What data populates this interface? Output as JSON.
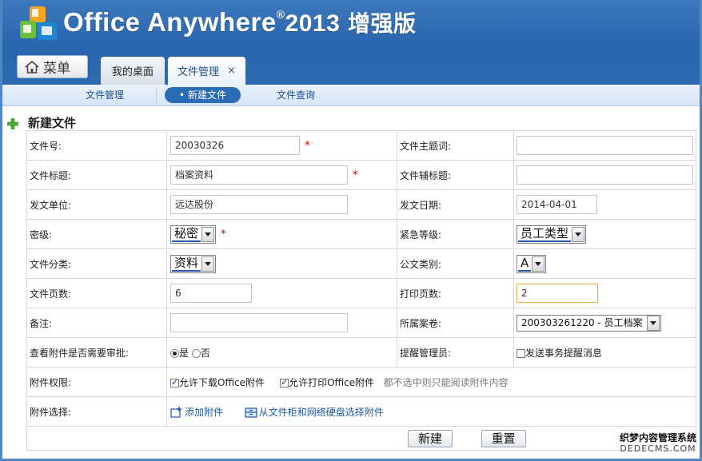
{
  "brand": {
    "name": "Office Anywhere",
    "reg": "®",
    "year": "2013",
    "edition": "增强版"
  },
  "colors": {
    "header": "#2a66ae",
    "accent": "#2b6cb6",
    "required": "#dd0000"
  },
  "menu_button": {
    "label": "菜单",
    "icon": "home-icon"
  },
  "tabs": [
    {
      "label": "我的桌面"
    },
    {
      "label": "文件管理",
      "close": "×"
    }
  ],
  "subnav": {
    "items": [
      {
        "label": "文件管理"
      },
      {
        "label": "新建文件",
        "bullet": "•"
      },
      {
        "label": "文件查询"
      }
    ]
  },
  "form": {
    "title": "新建文件",
    "required_mark": "*",
    "fields": {
      "file_no": {
        "label": "文件号:",
        "value": "20030326"
      },
      "file_keyword": {
        "label": "文件主题词:",
        "value": ""
      },
      "file_title": {
        "label": "文件标题:",
        "value": "档案资料"
      },
      "file_subtitle": {
        "label": "文件辅标题:",
        "value": ""
      },
      "issuer": {
        "label": "发文单位:",
        "value": "远达股份"
      },
      "issue_date": {
        "label": "发文日期:",
        "value": "2014-04-01"
      },
      "secrecy": {
        "label": "密级:",
        "value": "秘密"
      },
      "urgency": {
        "label": "紧急等级:",
        "value": "员工类型"
      },
      "category": {
        "label": "文件分类:",
        "value": "资料"
      },
      "doc_type": {
        "label": "公文类别:",
        "value": "A"
      },
      "page_count": {
        "label": "文件页数:",
        "value": "6"
      },
      "print_count": {
        "label": "打印页数:",
        "value": "2"
      },
      "remark": {
        "label": "备注:",
        "value": ""
      },
      "archive": {
        "label": "所属案卷:",
        "value": "200303261220 - 员工档案"
      },
      "need_approval": {
        "label": "查看附件是否需要审批:",
        "yes": "是",
        "no": "否"
      },
      "remind_admin": {
        "label": "提醒管理员:",
        "option": "发送事务提醒消息"
      },
      "attach_perm": {
        "label": "附件权限:",
        "download": "允许下载Office附件",
        "print": "允许打印Office附件",
        "hint": "都不选中则只能阅读附件内容"
      },
      "attach_select": {
        "label": "附件选择:",
        "add": "添加附件",
        "from_cabinet": "从文件柜和网络硬盘选择附件"
      }
    },
    "buttons": {
      "create": "新建",
      "reset": "重置"
    }
  },
  "watermark": {
    "line1": "织梦内容管理系统",
    "line2": "DEDECMS.COM"
  }
}
